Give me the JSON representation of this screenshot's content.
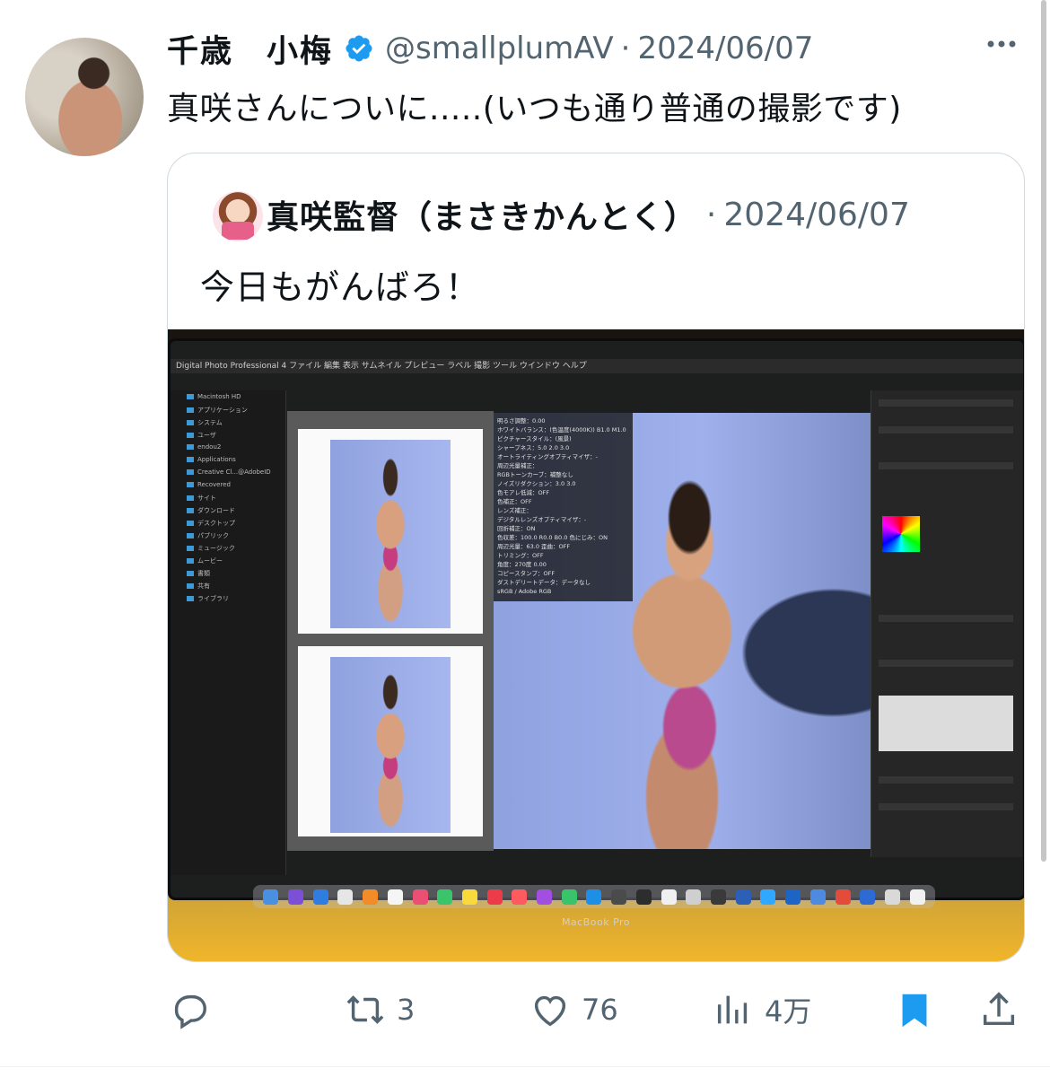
{
  "post": {
    "author_name": "千歳　小梅",
    "author_handle": "@smallplumAV",
    "separator": "·",
    "date": "2024/06/07",
    "text": "真咲さんについに.....(いつも通り普通の撮影です)"
  },
  "quoted_post": {
    "author_name": "真咲監督（まさきかんとく）",
    "separator": "·",
    "date": "2024/06/07",
    "text": "今日もがんばろ！",
    "photo": {
      "menu_bar": "Digital Photo Professional 4  ファイル  編集  表示  サムネイル  プレビュー  ラベル  撮影  ツール  ウインドウ  ヘルプ",
      "sidebar_items": [
        "Macintosh HD",
        "アプリケーション",
        "システム",
        "ユーザ",
        "endou2",
        "Applications",
        "Creative Cl...@AdobeID",
        "Recovered",
        "サイト",
        "ダウンロード",
        "デスクトップ",
        "パブリック",
        "ミュージック",
        "ムービー",
        "書類",
        "共有",
        "ライブラリ"
      ],
      "info_lines": [
        "明るさ調整：0.00",
        "ホワイトバランス：(色温度(4000K)) B1.0 M1.0",
        "ピクチャースタイル：(風景)",
        "シャープネス：5.0 2.0 3.0",
        "オートライティングオプティマイザ：-",
        "周辺光量補正：",
        "RGBトーンカーブ：補整なし",
        "ノイズリダクション：3.0 3.0",
        "色モアレ低減：OFF",
        "色補正：OFF",
        "レンズ補正：",
        "デジタルレンズオプティマイザ：-",
        "回折補正：ON",
        "色収差：100.0 R0.0 B0.0 色にじみ：ON",
        "周辺光量：63.0 歪曲：OFF",
        "トリミング：OFF",
        "角度：270度 0.00",
        "コピースタンプ：OFF",
        "ダストデリートデータ：データなし",
        "sRGB / Adobe RGB"
      ],
      "laptop_label": "MacBook Pro"
    }
  },
  "actions": {
    "retweet_count": "3",
    "like_count": "76",
    "view_count": "4万"
  },
  "colors": {
    "verified": "#1d9bf0",
    "bookmark_active": "#1d9bf0",
    "secondary_text": "#536471"
  }
}
